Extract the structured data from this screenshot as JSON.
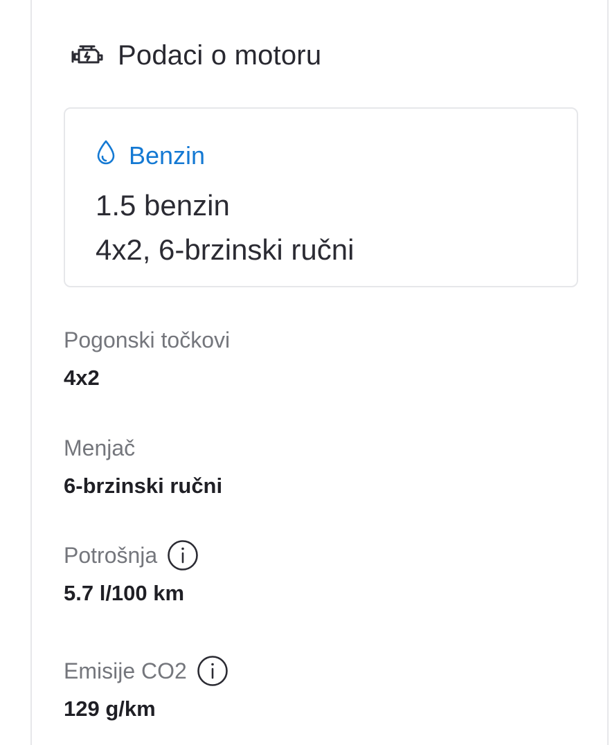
{
  "engine_section": {
    "title": "Podaci o motoru",
    "icon": "engine-icon"
  },
  "engine_card": {
    "fuel_icon": "droplet-icon",
    "fuel_type": "Benzin",
    "fuel_color": "#1479d3",
    "engine_name": "1.5 benzin",
    "drivetrain_summary": "4x2, 6-brzinski ručni"
  },
  "specs": [
    {
      "label": "Pogonski točkovi",
      "value": "4x2",
      "info": false
    },
    {
      "label": "Menjač",
      "value": "6-brzinski ručni",
      "info": false
    },
    {
      "label": "Potrošnja",
      "value": "5.7 l/100 km",
      "info": true,
      "info_icon": "info-icon"
    },
    {
      "label": "Emisije CO2",
      "value": "129 g/km",
      "info": true,
      "info_icon": "info-icon"
    }
  ]
}
